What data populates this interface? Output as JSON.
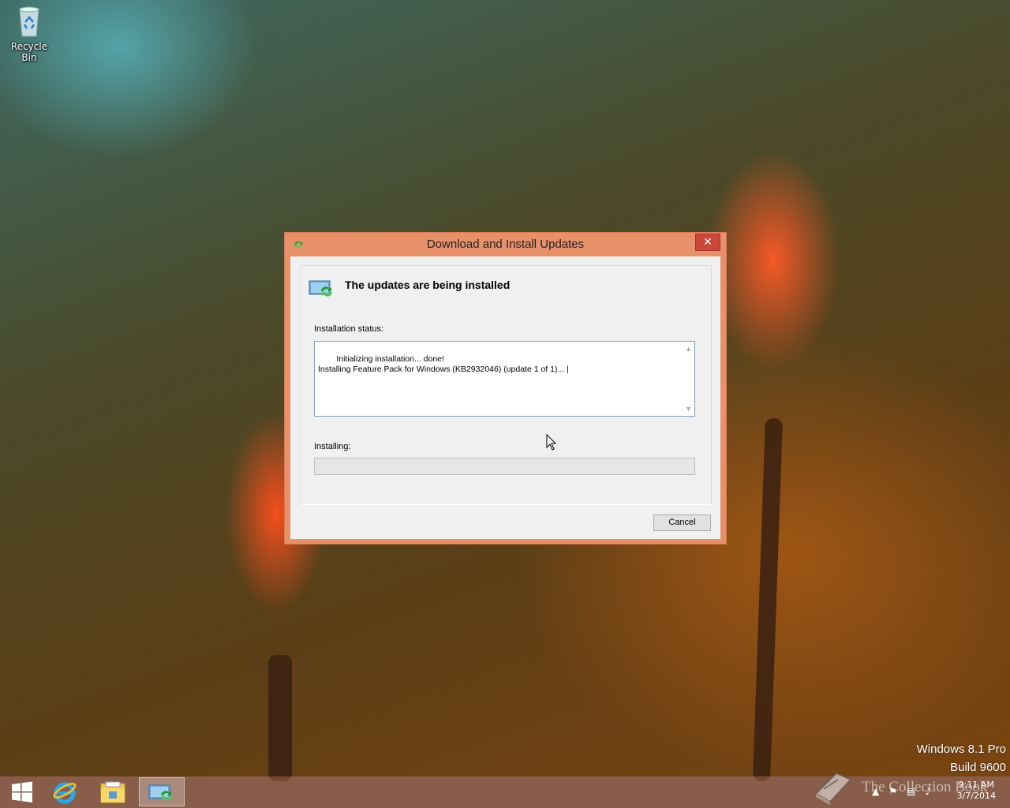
{
  "desktop": {
    "recycle_bin_label": "Recycle Bin",
    "watermark_line1": "Windows 8.1 Pro",
    "watermark_line2": "Build 9600",
    "overlay_text": "The Collection Book"
  },
  "dialog": {
    "title": "Download and Install Updates",
    "close_glyph": "✕",
    "heading": "The updates are being installed",
    "status_label": "Installation status:",
    "status_log": "Initializing installation... done!\nInstalling Feature Pack for Windows (KB2932046) (update 1 of 1)... |",
    "progress_label": "Installing:",
    "progress_value": 0,
    "cancel_label": "Cancel"
  },
  "taskbar": {
    "items": [
      {
        "name": "start-icon"
      },
      {
        "name": "internet-explorer-icon"
      },
      {
        "name": "file-explorer-icon"
      },
      {
        "name": "windows-update-icon",
        "active": true
      }
    ],
    "clock_time": "9:11 AM",
    "clock_date": "3/7/2014"
  },
  "colors": {
    "dialog_frame": "#e8906a",
    "close_button": "#c9483a",
    "taskbar": "#78483a"
  }
}
